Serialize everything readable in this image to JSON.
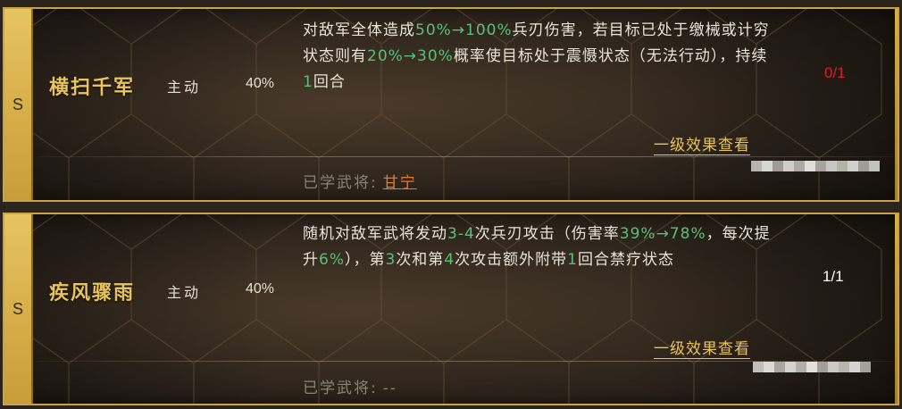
{
  "skills": [
    {
      "grade": "S",
      "name": "横扫千军",
      "type": "主动",
      "rate": "40%",
      "desc": {
        "p1": "对敌军全体造成",
        "v1": "50%→100%",
        "p2": "兵刃伤害，若目标已处于缴械或计穷状态则有",
        "v2": "20%→30%",
        "p3": "概率使目标处于震慑状态（无法行动），持续",
        "v3": "1",
        "p4": "回合"
      },
      "uses": "0/1",
      "link": "一级效果查看",
      "learned_label": "已学武将:",
      "learned_value": "甘宁"
    },
    {
      "grade": "S",
      "name": "疾风骤雨",
      "type": "主动",
      "rate": "40%",
      "desc": {
        "p1": "随机对敌军武将发动",
        "v1": "3-4",
        "p2": "次兵刃攻击（伤害率",
        "v2": "39%→78%",
        "p3": "，每次提升",
        "v3": "6%",
        "p4": "），第",
        "v4": "3",
        "p5": "次和第",
        "v5": "4",
        "p6": "次攻击额外附带",
        "v6": "1",
        "p7": "回合禁疗状态"
      },
      "uses": "1/1",
      "link": "一级效果查看",
      "learned_label": "已学武将:",
      "learned_value": "--"
    }
  ],
  "colors": {
    "highlight": "#57c07a",
    "gold": "#e8c45a",
    "uses_empty": "#d8202a",
    "general": "#e67a2e"
  }
}
